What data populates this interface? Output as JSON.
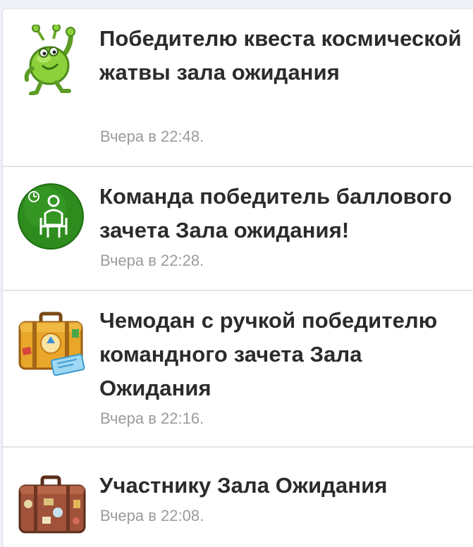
{
  "notifications": [
    {
      "icon": "alien-icon",
      "title": "Победителю квеста космической жатвы зала ожидания",
      "time": "Вчера в 22:48."
    },
    {
      "icon": "waiting-room-badge-icon",
      "title": "Команда победитель баллового зачета Зала ожидания!",
      "time": "Вчера в 22:28."
    },
    {
      "icon": "travel-suitcase-icon",
      "title": "Чемодан с ручкой победителю командного зачета Зала Ожидания",
      "time": "Вчера в 22:16."
    },
    {
      "icon": "brown-suitcase-icon",
      "title": "Участнику Зала Ожидания",
      "time": "Вчера в 22:08."
    }
  ]
}
